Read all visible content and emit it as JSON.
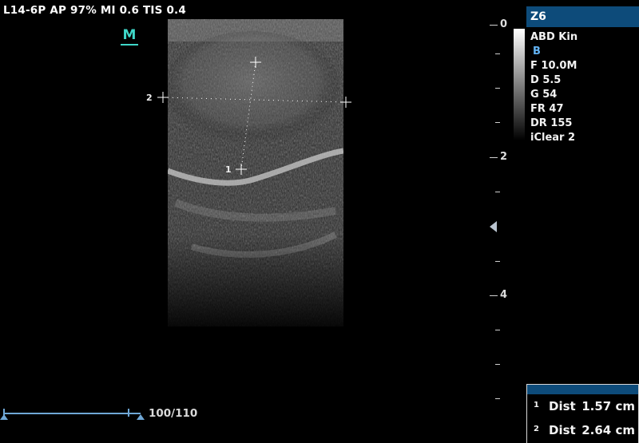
{
  "header": {
    "probe_info": "L14-6P  AP 97%  MI 0.6  TIS 0.4"
  },
  "logo": {
    "letter": "M",
    "color": "#3fd7c9"
  },
  "depth_scale": {
    "labels": [
      "0",
      "2",
      "4"
    ]
  },
  "panel": {
    "mode_label": "Z6",
    "preset": "ABD Kin",
    "image_mode": "B",
    "params": [
      "F 10.0M",
      "D 5.5",
      "G 54",
      "FR 47",
      "DR 155",
      "iClear 2"
    ]
  },
  "calipers": {
    "point1": "1",
    "point2": "2"
  },
  "measurements": [
    {
      "index": "1",
      "name": "Dist",
      "value": "1.57 cm"
    },
    {
      "index": "2",
      "name": "Dist",
      "value": "2.64 cm"
    }
  ],
  "slider": {
    "value": "100/110",
    "color": "#6fa7d6"
  },
  "colors": {
    "accent": "#0d4b7a",
    "background": "#000000"
  }
}
